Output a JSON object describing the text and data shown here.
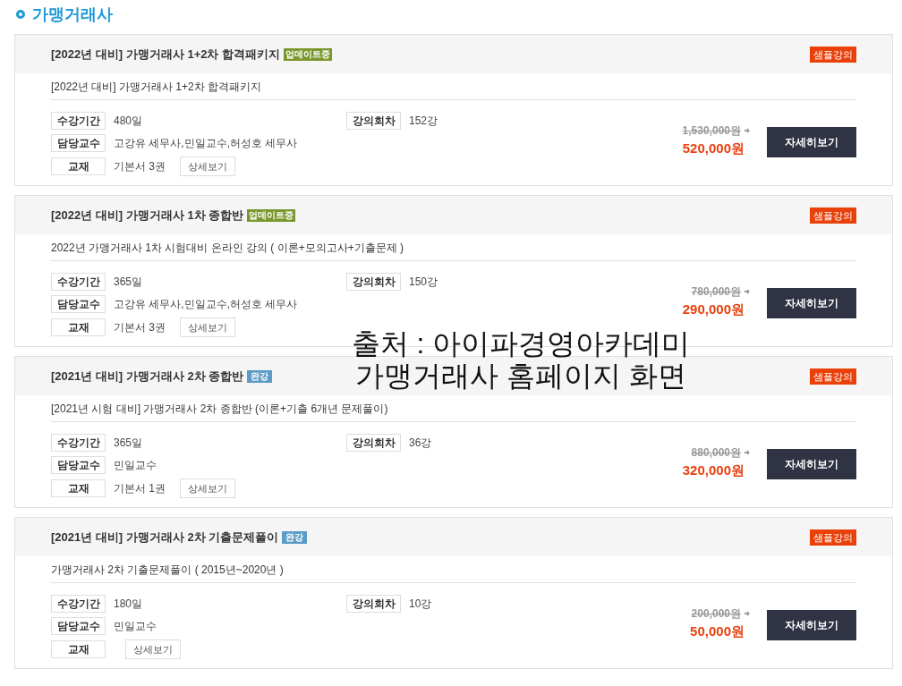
{
  "section": {
    "title": "가맹거래사"
  },
  "courses": [
    {
      "title": "[2022년 대비] 가맹거래사 1+2차 합격패키지",
      "status": {
        "kind": "updating",
        "label": "업데이트중"
      },
      "sample_label": "샘플강의",
      "description": "[2022년 대비] 가맹거래사 1+2차 합격패키지",
      "period": {
        "label": "수강기간",
        "value": "480일"
      },
      "sessions": {
        "label": "강의회차",
        "value": "152강"
      },
      "instructor": {
        "label": "담당교수",
        "value": "고강유 세무사,민일교수,허성호 세무사"
      },
      "textbook": {
        "label": "교재",
        "value": "기본서 3권",
        "button": "상세보기"
      },
      "original_price": "1,530,000원",
      "price": "520,000원",
      "detail_button": "자세히보기"
    },
    {
      "title": "[2022년 대비] 가맹거래사 1차 종합반",
      "status": {
        "kind": "updating",
        "label": "업데이트중"
      },
      "sample_label": "샘플강의",
      "description": "2022년 가맹거래사 1차 시험대비 온라인 강의 ( 이론+모의고사+기출문제 )",
      "period": {
        "label": "수강기간",
        "value": "365일"
      },
      "sessions": {
        "label": "강의회차",
        "value": "150강"
      },
      "instructor": {
        "label": "담당교수",
        "value": "고강유 세무사,민일교수,허성호 세무사"
      },
      "textbook": {
        "label": "교재",
        "value": "기본서 3권",
        "button": "상세보기"
      },
      "original_price": "780,000원",
      "price": "290,000원",
      "detail_button": "자세히보기"
    },
    {
      "title": "[2021년 대비] 가맹거래사 2차 종합반",
      "status": {
        "kind": "completed",
        "label": "완강"
      },
      "sample_label": "샘플강의",
      "description": "[2021년 시험 대비] 가맹거래사 2차 종합반 (이론+기출 6개년 문제풀이)",
      "period": {
        "label": "수강기간",
        "value": "365일"
      },
      "sessions": {
        "label": "강의회차",
        "value": "36강"
      },
      "instructor": {
        "label": "담당교수",
        "value": "민일교수"
      },
      "textbook": {
        "label": "교재",
        "value": "기본서 1권",
        "button": "상세보기"
      },
      "original_price": "880,000원",
      "price": "320,000원",
      "detail_button": "자세히보기"
    },
    {
      "title": "[2021년 대비] 가맹거래사 2차 기출문제풀이",
      "status": {
        "kind": "completed",
        "label": "완강"
      },
      "sample_label": "샘플강의",
      "description": "가맹거래사 2차 기출문제풀이 ( 2015년~2020년 )",
      "period": {
        "label": "수강기간",
        "value": "180일"
      },
      "sessions": {
        "label": "강의회차",
        "value": "10강"
      },
      "instructor": {
        "label": "담당교수",
        "value": "민일교수"
      },
      "textbook": {
        "label": "교재",
        "button": "상세보기"
      },
      "original_price": "200,000원",
      "price": "50,000원",
      "detail_button": "자세히보기"
    }
  ],
  "caption": [
    "출처 : 아이파경영아카데미",
    "가맹거래사 홈페이지 화면"
  ]
}
